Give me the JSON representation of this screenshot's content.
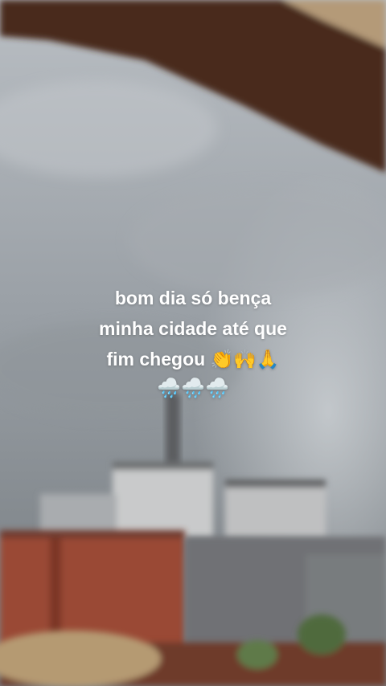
{
  "story": {
    "caption_lines": [
      "bom dia só bença",
      "minha cidade até que",
      "fim chegou 👏🙌🙏"
    ],
    "emoji_line": "🌧️🌧️🌧️"
  }
}
